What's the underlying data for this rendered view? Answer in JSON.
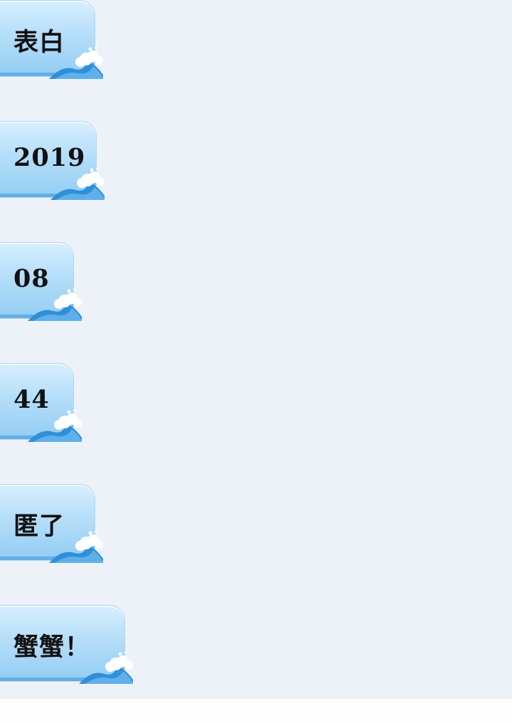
{
  "messages": [
    {
      "text": "表白"
    },
    {
      "text": "2019"
    },
    {
      "text": "08"
    },
    {
      "text": "44"
    },
    {
      "text": "匿了"
    },
    {
      "text": "蟹蟹！"
    }
  ],
  "colors": {
    "background": "#edf2f8",
    "bubble_top": "#d7efff",
    "bubble_bottom": "#93cdf3",
    "wave": "#2f8fd8"
  },
  "icons": {
    "bubble_decoration": "wave-splash-icon"
  }
}
